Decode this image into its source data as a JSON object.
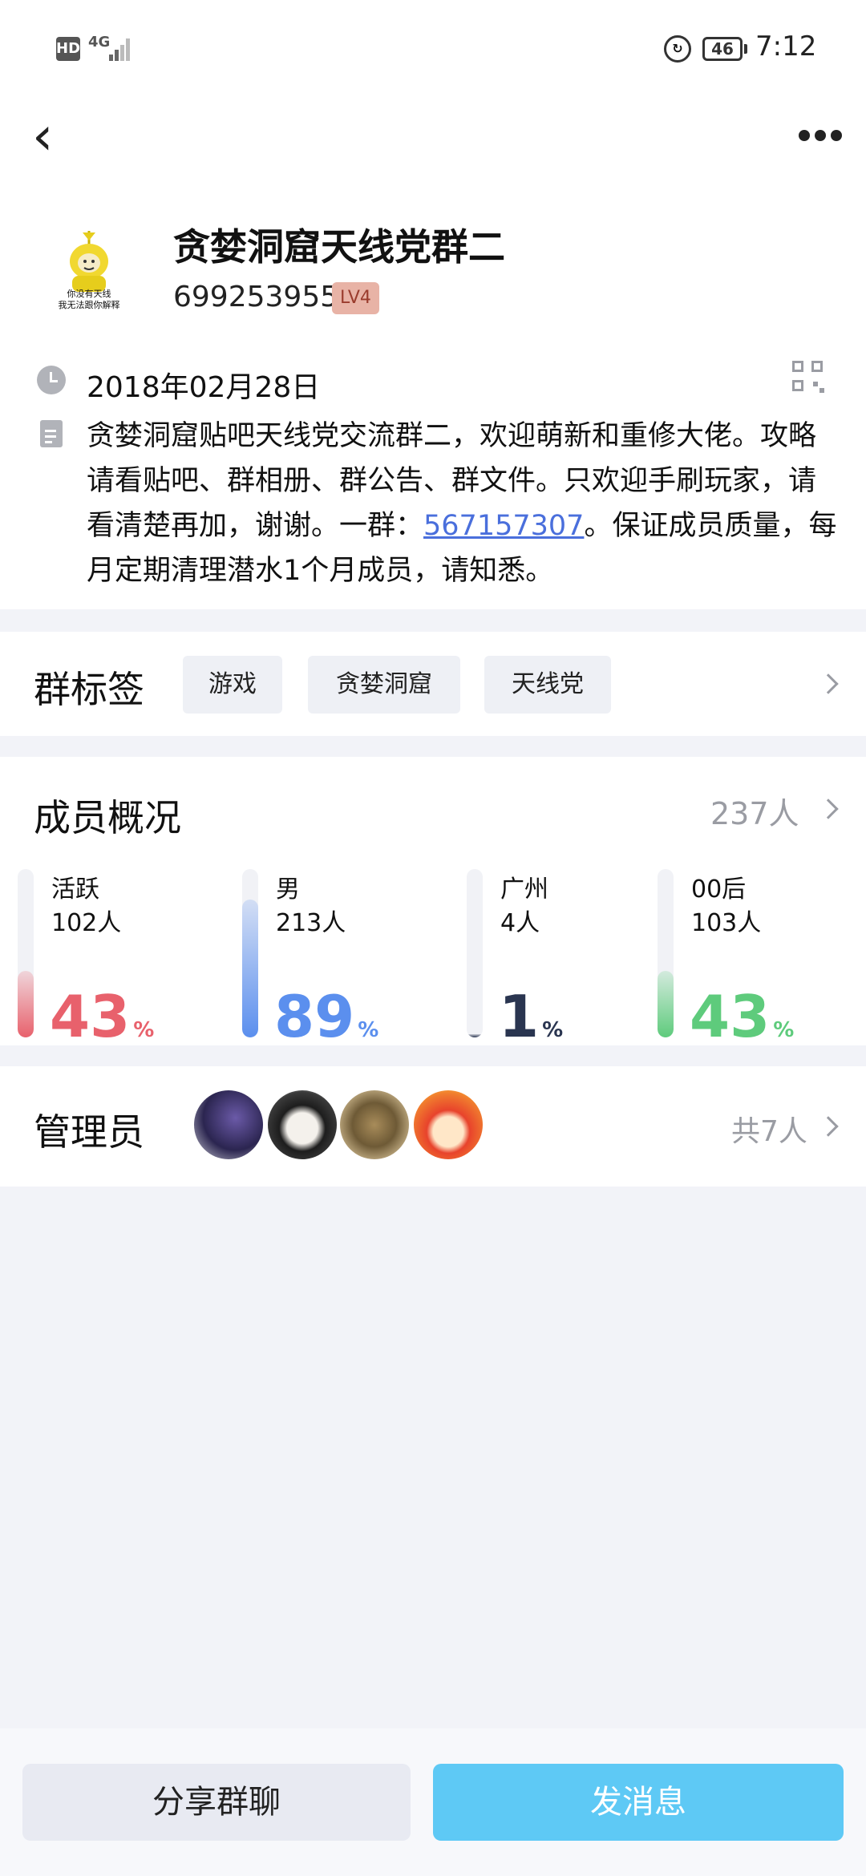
{
  "status_bar": {
    "hd": "HD",
    "network": "4G",
    "battery": "46",
    "time": "7:12"
  },
  "header": {
    "back_icon": "back-arrow-icon",
    "more_icon": "more-dots-icon"
  },
  "group": {
    "name": "贪婪洞窟天线党群二",
    "id": "699253955",
    "level": "LV4",
    "avatar_caption_1": "你没有天线",
    "avatar_caption_2": "我无法跟你解释",
    "created_date": "2018年02月28日",
    "description_prefix": "贪婪洞窟贴吧天线党交流群二，欢迎萌新和重修大佬。攻略请看贴吧、群相册、群公告、群文件。只欢迎手刷玩家，请看清楚再加，谢谢。一群：",
    "description_link": "567157307",
    "description_suffix": "。保证成员质量，每月定期清理潜水1个月成员，请知悉。"
  },
  "tags": {
    "title": "群标签",
    "items": [
      "游戏",
      "贪婪洞窟",
      "天线党"
    ]
  },
  "members": {
    "title": "成员概况",
    "total": "237人",
    "stats": [
      {
        "label": "活跃",
        "count": "102人",
        "percent": "43",
        "pct_sign": "%",
        "fraction": 0.43,
        "color": "#e8616c"
      },
      {
        "label": "男",
        "count": "213人",
        "percent": "89",
        "pct_sign": "%",
        "fraction": 0.89,
        "color": "#5b8fee"
      },
      {
        "label": "广州",
        "count": "4人",
        "percent": "1",
        "pct_sign": "%",
        "fraction": 0.01,
        "color": "#2a3550"
      },
      {
        "label": "00后",
        "count": "103人",
        "percent": "43",
        "pct_sign": "%",
        "fraction": 0.43,
        "color": "#5ecb7c"
      }
    ]
  },
  "admins": {
    "title": "管理员",
    "count": "共7人"
  },
  "actions": {
    "share": "分享群聊",
    "message": "发消息"
  }
}
